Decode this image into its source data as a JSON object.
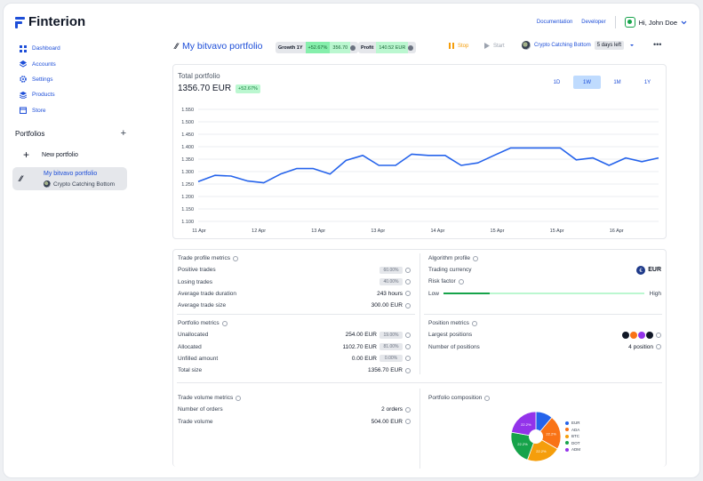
{
  "app": {
    "brand": "Finterion"
  },
  "topbar": {
    "documentation": "Documentation",
    "developer": "Developer",
    "user": "Hi, John Doe"
  },
  "nav": [
    {
      "label": "Dashboard",
      "icon": "grid-icon"
    },
    {
      "label": "Accounts",
      "icon": "layers-icon"
    },
    {
      "label": "Settings",
      "icon": "gear-icon"
    },
    {
      "label": "Products",
      "icon": "stack-icon"
    },
    {
      "label": "Store",
      "icon": "store-icon"
    }
  ],
  "portfolios": {
    "heading": "Portfolios",
    "new_label": "New portfolio",
    "items": [
      {
        "name": "My bitvavo portfolio",
        "bot": "Crypto Catching Bottom"
      }
    ]
  },
  "header": {
    "title": "My bitvavo portfolio",
    "growth_label": "Growth 1Y",
    "growth_pct": "+52.67%",
    "growth_value": "356.70",
    "profit_label": "Profit",
    "profit_value": "140.52 EUR",
    "stop": "Stop",
    "start": "Start",
    "bot_name": "Crypto Catching Bottom",
    "days_left": "5 days left"
  },
  "chart": {
    "label": "Total portfolio",
    "value": "1356.70 EUR",
    "change": "+52.67%",
    "ranges": [
      "1D",
      "1W",
      "1M",
      "1Y"
    ],
    "active_range": "1W"
  },
  "chart_data": {
    "type": "line",
    "color": "#2563eb",
    "ylim": [
      1100,
      1550
    ],
    "yticks": [
      "1.550",
      "1.500",
      "1.450",
      "1.400",
      "1.350",
      "1.300",
      "1.250",
      "1.200",
      "1.150",
      "1.100"
    ],
    "xticks": [
      "11 Apr",
      "12 Apr",
      "13 Apr",
      "13 Apr",
      "14 Apr",
      "15 Apr",
      "15 Apr",
      "16 Apr"
    ],
    "x": [
      0,
      0.29,
      0.57,
      0.86,
      1.14,
      1.43,
      1.71,
      2.0,
      2.29,
      2.57,
      2.86,
      3.14,
      3.43,
      3.71,
      4.0,
      4.29,
      4.57,
      4.86,
      5.14,
      5.43,
      5.71,
      6.0,
      6.29,
      6.57,
      6.86,
      7.14,
      7.43,
      7.71,
      8.0
    ],
    "values": [
      1260,
      1285,
      1282,
      1262,
      1255,
      1290,
      1312,
      1312,
      1290,
      1345,
      1365,
      1325,
      1325,
      1370,
      1365,
      1365,
      1325,
      1335,
      1365,
      1395,
      1395,
      1395,
      1395,
      1347,
      1355,
      1325,
      1355,
      1340,
      1355
    ]
  },
  "trade_profile": {
    "title": "Trade profile metrics",
    "rows": [
      {
        "label": "Positive trades",
        "badge": "60.00%"
      },
      {
        "label": "Losing trades",
        "badge": "40.00%"
      },
      {
        "label": "Average trade duration",
        "value": "243 hours"
      },
      {
        "label": "Average trade size",
        "value": "300.00 EUR"
      }
    ]
  },
  "algorithm": {
    "title": "Algorithm profile",
    "currency_label": "Trading currency",
    "currency": "EUR",
    "risk_label": "Risk factor",
    "risk_level": 0.23,
    "low": "Low",
    "high": "High"
  },
  "portfolio_metrics": {
    "title": "Portfolio metrics",
    "rows": [
      {
        "label": "Unallocated",
        "value": "254.00 EUR",
        "badge": "19.00%"
      },
      {
        "label": "Allocated",
        "value": "1102.70 EUR",
        "badge": "81.00%"
      },
      {
        "label": "Unfilled amount",
        "value": "0.00 EUR",
        "badge": "0.00%"
      },
      {
        "label": "Total size",
        "value": "1356.70 EUR"
      }
    ]
  },
  "position_metrics": {
    "title": "Position metrics",
    "largest_label": "Largest positions",
    "count_label": "Number of positions",
    "count_value": "4 position",
    "coins": [
      "#111827",
      "#f97316",
      "#9333ea",
      "#111827"
    ]
  },
  "trade_volume": {
    "title": "Trade volume metrics",
    "rows": [
      {
        "label": "Number of orders",
        "value": "2 orders"
      },
      {
        "label": "Trade volume",
        "value": "504.00 EUR"
      }
    ]
  },
  "composition": {
    "title": "Portfolio composition",
    "slices": [
      {
        "name": "EUR",
        "pct": 11.1,
        "label": "",
        "color": "#2563eb"
      },
      {
        "name": "ADA",
        "pct": 22.2,
        "label": "22.2%",
        "color": "#f97316"
      },
      {
        "name": "BTC",
        "pct": 22.2,
        "label": "22.2%",
        "color": "#f59e0b"
      },
      {
        "name": "DOT",
        "pct": 22.2,
        "label": "22.2%",
        "color": "#16a34a"
      },
      {
        "name": "ADM",
        "pct": 22.2,
        "label": "22.2%",
        "color": "#9333ea"
      }
    ]
  }
}
